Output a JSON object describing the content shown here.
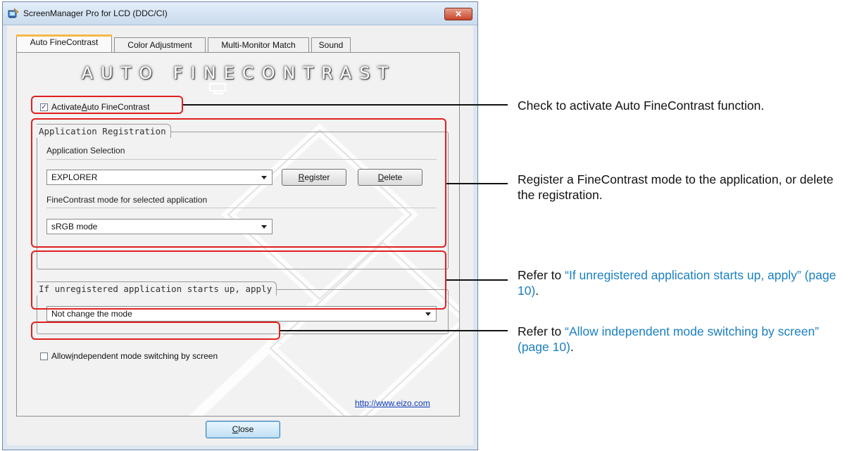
{
  "window": {
    "title": "ScreenManager Pro for LCD (DDC/CI)",
    "close_glyph": "✕"
  },
  "tabs": [
    {
      "label": "Auto FineContrast",
      "active": true
    },
    {
      "label": "Color Adjustment",
      "active": false
    },
    {
      "label": "Multi-Monitor Match",
      "active": false
    },
    {
      "label": "Sound",
      "active": false
    }
  ],
  "panel": {
    "brand": "AUTO FINECONTRAST",
    "activate": {
      "label_pre": "Activate ",
      "label_ul": "A",
      "label_post": "uto FineContrast",
      "checked": true
    },
    "app_registration": {
      "group_title": "Application Registration",
      "selection_label": "Application Selection",
      "selection_value": "EXPLORER",
      "register_pre": "",
      "register_ul": "R",
      "register_post": "egister",
      "delete_pre": "",
      "delete_ul": "D",
      "delete_post": "elete",
      "mode_label": "FineContrast mode for selected application",
      "mode_value": "sRGB mode"
    },
    "unregistered": {
      "group_title": "If unregistered application starts up, apply",
      "value": "Not change the mode"
    },
    "independent": {
      "label_pre": "Allow ",
      "label_ul": "i",
      "label_post": "ndependent mode switching by screen",
      "checked": false
    },
    "link": "http://www.eizo.com"
  },
  "close_button": {
    "pre": "",
    "ul": "C",
    "post": "lose"
  },
  "annotations": [
    {
      "text": "Check to activate Auto FineContrast function.",
      "ref": ""
    },
    {
      "text": "Register a FineContrast mode to the application, or delete the registration.",
      "ref": ""
    },
    {
      "text": "Refer to ",
      "ref": "“If unregistered application starts up, apply” (page 10)",
      "tail": "."
    },
    {
      "text": "Refer to ",
      "ref": "“Allow independent mode switching by screen” (page 10)",
      "tail": "."
    }
  ],
  "colors": {
    "callout": "#e02020",
    "reference": "#1a7fc0",
    "tab_accent": "#f6b844"
  }
}
